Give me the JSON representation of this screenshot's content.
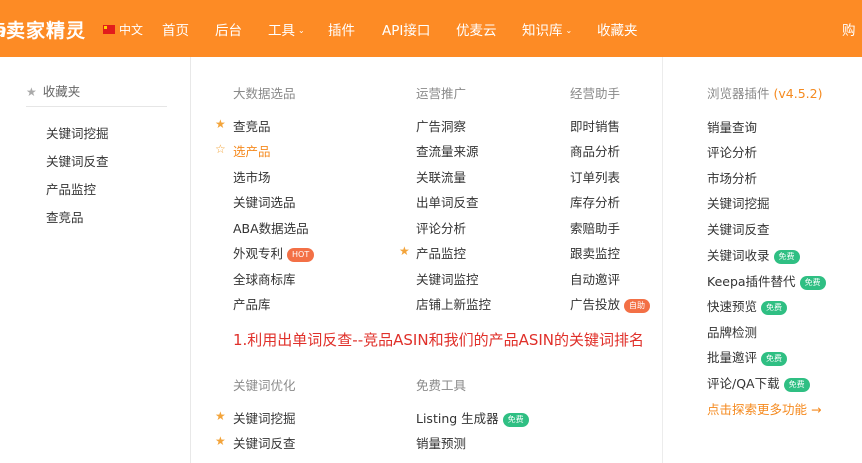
{
  "brand": {
    "name": "卖家精灵",
    "language": "中文"
  },
  "nav": [
    "首页",
    "后台",
    "工具",
    "插件",
    "API接口",
    "优麦云",
    "知识库",
    "收藏夹",
    "购"
  ],
  "favorites": {
    "title": "收藏夹",
    "items": [
      "关键词挖掘",
      "关键词反查",
      "产品监控",
      "查竞品"
    ]
  },
  "columns": {
    "big_data": {
      "title": "大数据选品",
      "items": [
        "查竞品",
        "选产品",
        "选市场",
        "关键词选品",
        "ABA数据选品",
        "外观专利",
        "全球商标库",
        "产品库"
      ],
      "hot_badge": "HOT"
    },
    "promotion": {
      "title": "运营推广",
      "items": [
        "广告洞察",
        "查流量来源",
        "关联流量",
        "出单词反查",
        "评论分析",
        "产品监控",
        "关键词监控",
        "店铺上新监控"
      ]
    },
    "assistant": {
      "title": "经营助手",
      "items": [
        "即时销售",
        "商品分析",
        "订单列表",
        "库存分析",
        "索赔助手",
        "跟卖监控",
        "自动邀评",
        "广告投放"
      ],
      "auto_badge": "自助"
    },
    "keyword_opt": {
      "title": "关键词优化",
      "items": [
        "关键词挖掘",
        "关键词反查"
      ]
    },
    "free_tools": {
      "title": "免费工具",
      "items": [
        "Listing 生成器",
        "销量预测"
      ],
      "free_badge": "免费"
    },
    "browser_plugin": {
      "title": "浏览器插件",
      "version": "(v4.5.2)",
      "items": [
        "销量查询",
        "评论分析",
        "市场分析",
        "关键词挖掘",
        "关键词反查",
        "关键词收录",
        "Keepa插件替代",
        "快速预览",
        "品牌检测",
        "批量邀评",
        "评论/QA下载"
      ],
      "free_badge": "免费",
      "more": "点击探索更多功能 →"
    }
  },
  "annotation": "1.利用出单词反查--竞品ASIN和我们的产品ASIN的关键词排名",
  "colors": {
    "topbar": "#fd8b25",
    "accent": "#f58a1f",
    "annotation": "#e0302a"
  }
}
